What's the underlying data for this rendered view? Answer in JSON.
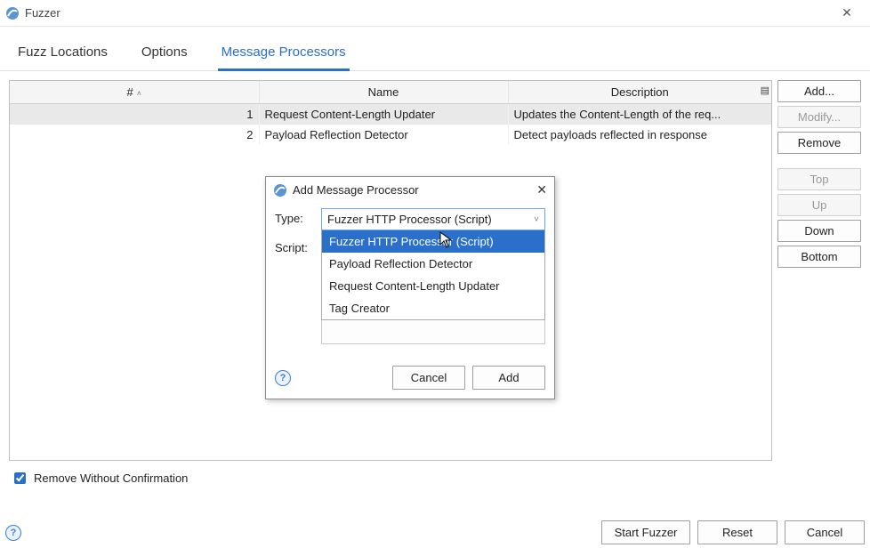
{
  "window": {
    "title": "Fuzzer",
    "close_glyph": "✕"
  },
  "tabs": {
    "fuzz": "Fuzz Locations",
    "options": "Options",
    "msgproc": "Message Processors",
    "active": "msgproc"
  },
  "table": {
    "headers": {
      "num": "#",
      "name": "Name",
      "desc": "Description"
    },
    "rows": [
      {
        "num": "1",
        "name": "Request Content-Length Updater",
        "desc": "Updates the Content-Length of the req...",
        "selected": true
      },
      {
        "num": "2",
        "name": "Payload Reflection Detector",
        "desc": "Detect payloads reflected in response",
        "selected": false
      }
    ]
  },
  "side": {
    "add": "Add...",
    "modify": "Modify...",
    "remove": "Remove",
    "top": "Top",
    "up": "Up",
    "down": "Down",
    "bottom": "Bottom"
  },
  "checkbox": {
    "label": "Remove Without Confirmation",
    "checked": true
  },
  "footer": {
    "start": "Start Fuzzer",
    "reset": "Reset",
    "cancel": "Cancel"
  },
  "dialog": {
    "title": "Add Message Processor",
    "close_glyph": "✕",
    "type_label": "Type:",
    "script_label": "Script:",
    "selected": "Fuzzer HTTP Processor (Script)",
    "options": [
      "Fuzzer HTTP Processor (Script)",
      "Payload Reflection Detector",
      "Request Content-Length Updater",
      "Tag Creator"
    ],
    "cancel": "Cancel",
    "add": "Add"
  },
  "icons": {
    "help_glyph": "?",
    "sort_glyph": "˄",
    "config_glyph": "▤",
    "chevron_glyph": "˅"
  }
}
